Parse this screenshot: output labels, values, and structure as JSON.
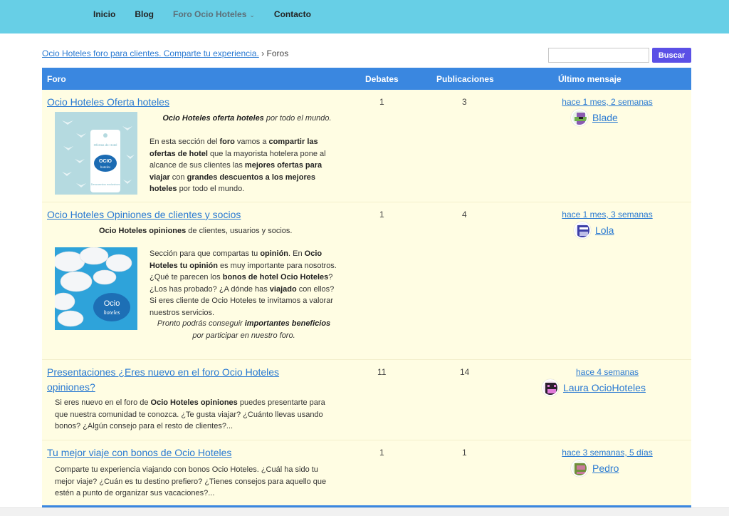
{
  "nav": {
    "items": [
      {
        "label": "Inicio"
      },
      {
        "label": "Blog"
      },
      {
        "label": "Foro Ocio Hoteles"
      },
      {
        "label": "Contacto"
      }
    ]
  },
  "breadcrumb": {
    "link": "Ocio Hoteles foro para clientes. Comparte tu experiencia.",
    "separator": "›",
    "current": "Foros"
  },
  "search": {
    "placeholder": "",
    "value": "",
    "button": "Buscar"
  },
  "table": {
    "headers": {
      "foro": "Foro",
      "debates": "Debates",
      "publicaciones": "Publicaciones",
      "ultimo": "Último mensaje"
    },
    "rows": [
      {
        "title": "Ocio Hoteles Oferta hoteles",
        "debates": "1",
        "publicaciones": "3",
        "when": "hace 1 mes, 2 semanas",
        "author": "Blade",
        "tagline_bold": "Ocio Hoteles oferta hoteles",
        "tagline_rest": " por todo el mundo.",
        "image_label_1": "Ofertas de Hotel",
        "image_logo": "OCIO",
        "image_logo_sub": "hoteles",
        "image_label_2": "Descuentos exclusivos"
      },
      {
        "title": "Ocio Hoteles Opiniones de clientes y socios",
        "debates": "1",
        "publicaciones": "4",
        "when": "hace 1 mes, 3 semanas",
        "author": "Lola",
        "intro_bold": "Ocio Hoteles opiniones",
        "intro_rest": "  de clientes, usuarios y socios.",
        "image_logo": "Ocio",
        "image_logo_sub": "hoteles",
        "promo_1": "Pronto podrás conseguir ",
        "promo_bold": "importantes beneficios",
        "promo_2": "por participar en nuestro foro."
      },
      {
        "title": "Presentaciones ¿Eres nuevo en el foro Ocio Hoteles opiniones?",
        "debates": "11",
        "publicaciones": "14",
        "when": "hace 4 semanas",
        "author": "Laura OcioHoteles"
      },
      {
        "title": "Tu mejor viaje con bonos de Ocio Hoteles",
        "debates": "1",
        "publicaciones": "1",
        "when": "hace 3 semanas, 5 días",
        "author": "Pedro",
        "desc": "Comparte tu experiencia viajando con bonos Ocio Hoteles. ¿Cuál ha sido tu mejor viaje? ¿Cuán es tu destino prefiero? ¿Tienes consejos para aquello que estén a punto de organizar sus vacaciones?..."
      }
    ]
  },
  "colors": {
    "topbar": "#67cfe6",
    "header": "#3a87e0",
    "row_bg": "#fffde3",
    "link": "#2a7ad2",
    "search_button": "#5b50e6"
  },
  "icons": [
    "chevron-down-icon",
    "avatar-blade",
    "avatar-lola",
    "avatar-laura",
    "avatar-pedro"
  ]
}
